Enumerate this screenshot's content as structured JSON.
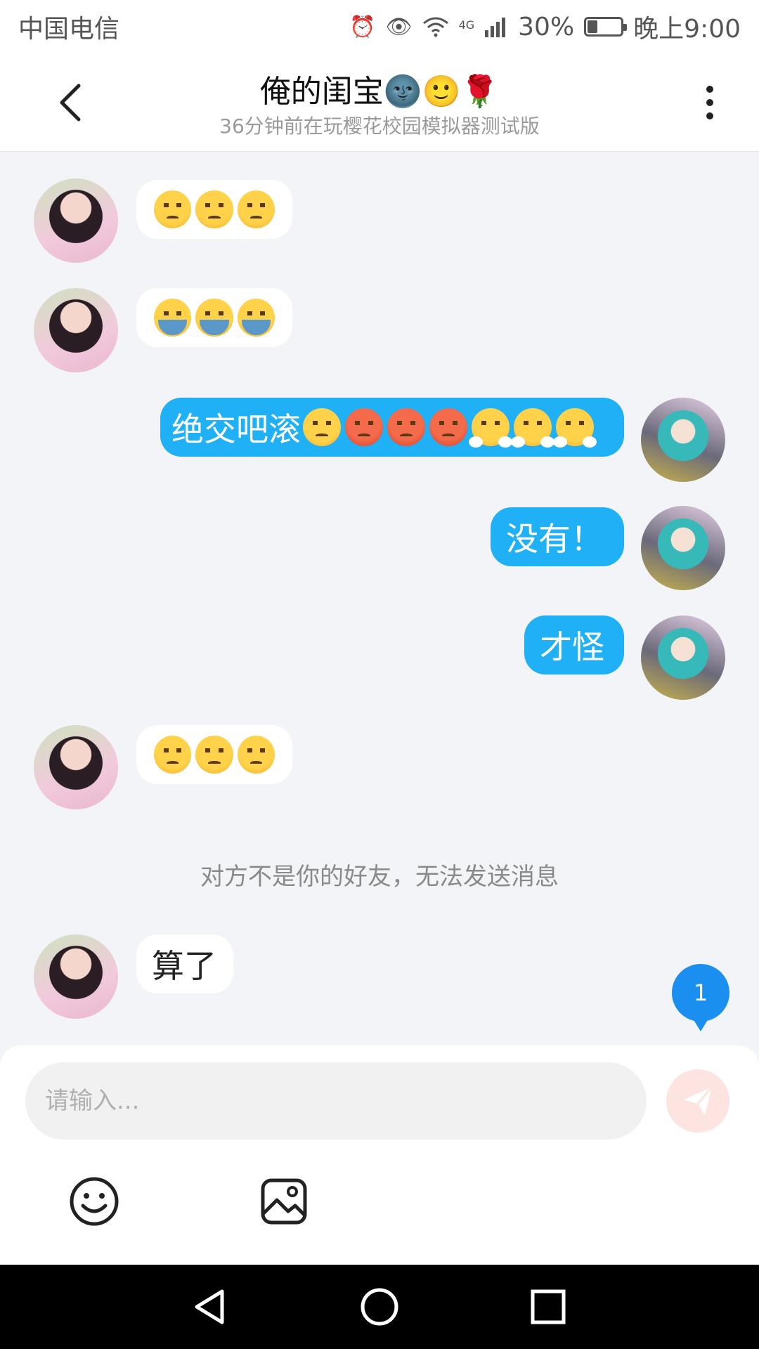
{
  "status_bar": {
    "carrier": "中国电信",
    "network": "4G",
    "battery": "30%",
    "battery_level": 0.3,
    "time": "晚上9:00"
  },
  "header": {
    "title": "俺的闺宝🌚🙂🌹",
    "subtitle": "36分钟前在玩樱花校园模拟器测试版"
  },
  "messages": [
    {
      "sender": "them",
      "emojis": [
        "worried",
        "worried",
        "worried"
      ]
    },
    {
      "sender": "them",
      "emojis": [
        "loudly-crying",
        "loudly-crying",
        "loudly-crying"
      ]
    },
    {
      "sender": "me",
      "text": "绝交吧滚",
      "emojis": [
        "unamused",
        "angry",
        "angry",
        "angry",
        "triumph",
        "triumph",
        "triumph"
      ]
    },
    {
      "sender": "me",
      "text": "没有！"
    },
    {
      "sender": "me",
      "text": "才怪"
    },
    {
      "sender": "them",
      "emojis": [
        "pensive",
        "pensive",
        "pensive"
      ]
    },
    {
      "sender": "them",
      "text": "算了"
    }
  ],
  "notice": "对方不是你的好友，无法发送消息",
  "unread_badge": "1",
  "input": {
    "placeholder": "请输入..."
  },
  "colors": {
    "accent": "#1fb0f5",
    "badge": "#1a8ff0",
    "background": "#f2f4f7"
  },
  "icons": {
    "back": "back-arrow-icon",
    "more": "more-vertical-icon",
    "send": "send-icon",
    "emoji": "smiley-icon",
    "image": "image-icon"
  }
}
